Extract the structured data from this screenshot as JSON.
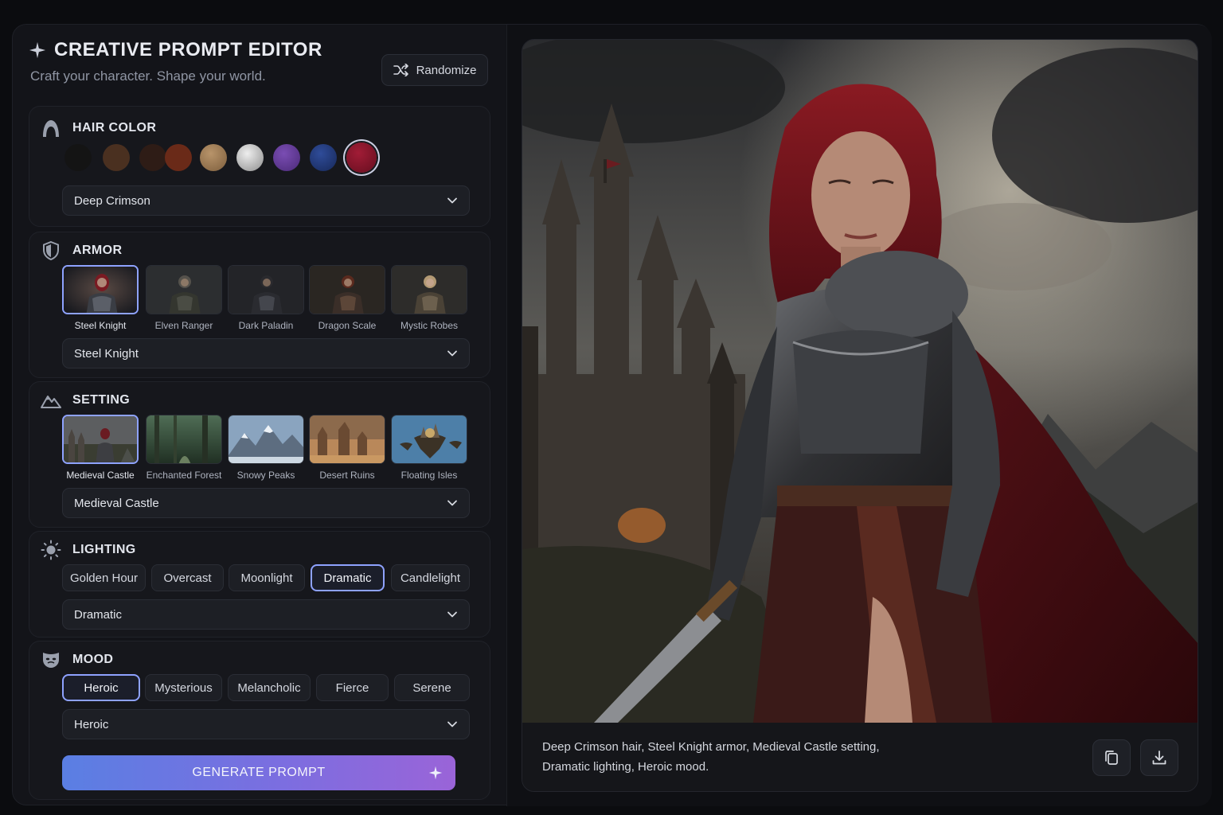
{
  "header": {
    "title": "CREATIVE PROMPT EDITOR",
    "subtitle": "Craft your character. Shape your world.",
    "randomize_label": "Randomize"
  },
  "hair": {
    "title": "HAIR COLOR",
    "swatches": [
      {
        "name": "black",
        "color": "#141414"
      },
      {
        "name": "brown",
        "color": "#4a3020"
      },
      {
        "name": "dark-brown",
        "color": "#2e1c16"
      },
      {
        "name": "auburn",
        "color": "#6a2a18"
      },
      {
        "name": "dirty-blonde",
        "color": "#9a7a55"
      },
      {
        "name": "silver",
        "color": "#c4c4c4"
      },
      {
        "name": "purple",
        "color": "#5e3891"
      },
      {
        "name": "blue",
        "color": "#1f3573"
      },
      {
        "name": "deep-crimson",
        "color": "#7a1226"
      }
    ],
    "selected": "Deep Crimson"
  },
  "armor": {
    "title": "ARMOR",
    "options": [
      "Steel Knight",
      "Elven Ranger",
      "Dark Paladin",
      "Dragon Scale",
      "Mystic Robes"
    ],
    "selected": "Steel Knight"
  },
  "setting": {
    "title": "SETTING",
    "options": [
      "Medieval Castle",
      "Enchanted Forest",
      "Snowy Peaks",
      "Desert Ruins",
      "Floating Isles"
    ],
    "selected": "Medieval Castle"
  },
  "lighting": {
    "title": "LIGHTING",
    "options": [
      "Golden Hour",
      "Overcast",
      "Moonlight",
      "Dramatic",
      "Candlelight"
    ],
    "selected": "Dramatic"
  },
  "mood": {
    "title": "MOOD",
    "options": [
      "Heroic",
      "Mysterious",
      "Melancholic",
      "Fierce",
      "Serene"
    ],
    "selected": "Heroic"
  },
  "generate_label": "GENERATE PROMPT",
  "preview": {
    "caption_line1": "Deep Crimson hair, Steel Knight armor, Medieval Castle setting,",
    "caption_line2": "Dramatic lighting, Heroic mood."
  },
  "colors": {
    "accent": "#8ea2ff",
    "gradient_start": "#5a7fe3",
    "gradient_end": "#9a64d8"
  },
  "icons": [
    "sparkle-icon",
    "shuffle-icon",
    "hair-icon",
    "shield-icon",
    "mountain-icon",
    "sun-icon",
    "mask-icon",
    "chevron-down-icon",
    "copy-icon",
    "download-icon"
  ]
}
